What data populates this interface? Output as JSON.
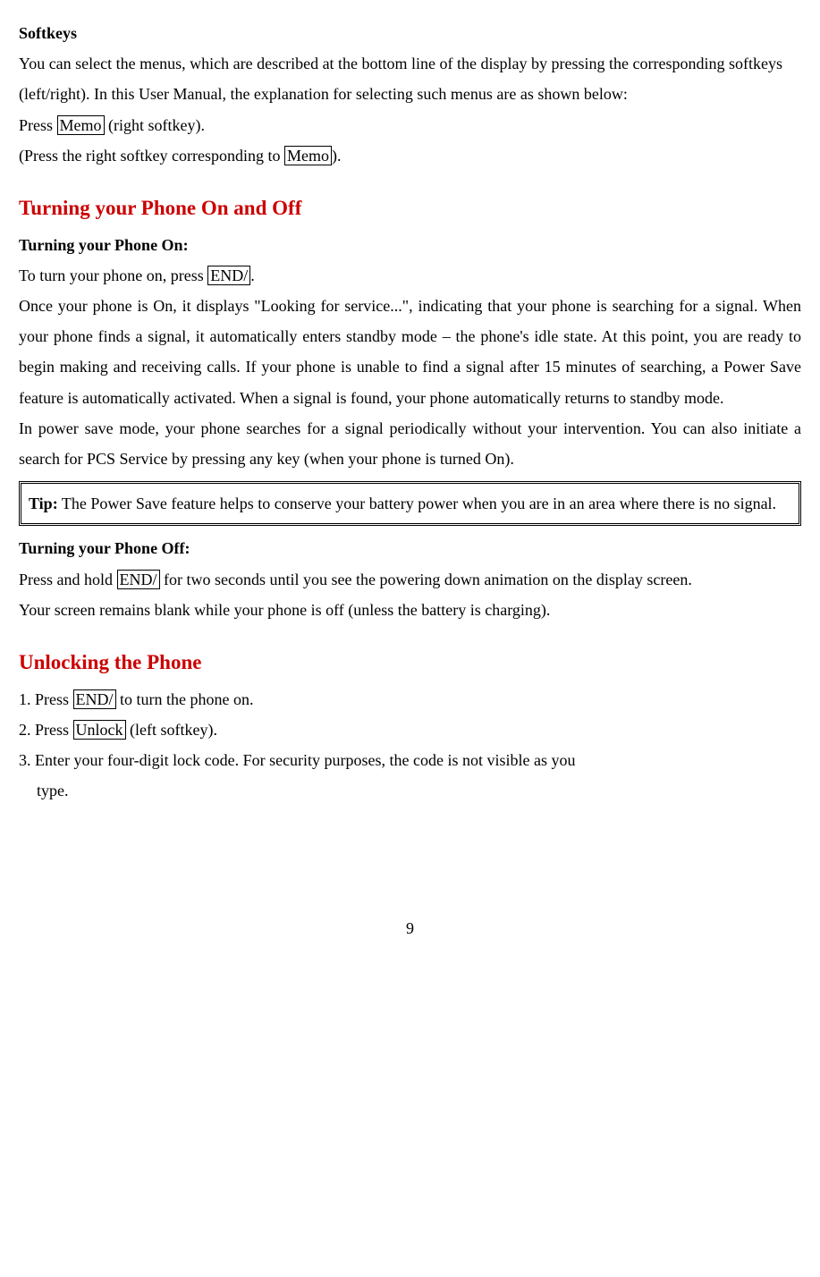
{
  "softkeys": {
    "heading": "Softkeys",
    "para1_a": "You can select the menus, which are described at the bottom line of the display by pressing the corresponding softkeys (left/right). In this User Manual, the explanation for selecting such menus are as shown below:",
    "para2_a": "Press ",
    "para2_boxed": "Memo",
    "para2_b": " (right softkey).",
    "para3_a": "(Press the right softkey corresponding to ",
    "para3_boxed": "Memo",
    "para3_b": ")."
  },
  "turning": {
    "main_heading": "Turning your Phone On and Off",
    "on_heading": "Turning your Phone On:",
    "on_p1_a": "To turn your phone on, press ",
    "on_p1_boxed": "END/",
    "on_p1_b": ".",
    "on_p2": "Once your phone is On, it displays \"Looking for service...\", indicating that your phone is searching for a signal. When your phone finds a signal, it automatically enters standby mode – the phone's idle state. At this point, you are ready to begin making and receiving calls. If your phone is unable to find a signal after 15 minutes of searching, a Power Save feature is automatically activated. When a signal is found, your phone automatically returns to standby mode.",
    "on_p3": "In power save mode, your phone searches for a signal periodically without your intervention. You can also initiate a search for PCS Service by pressing any key (when your phone is turned On).",
    "tip_label": "Tip:",
    "tip_text": " The Power Save feature helps to conserve your battery power when you are in an area where there is no signal.",
    "off_heading": "Turning your Phone Off:",
    "off_p1_a": "Press and hold ",
    "off_p1_boxed": "END/",
    "off_p1_b": " for two seconds until you see the powering down animation on the display screen.",
    "off_p2": "Your screen remains blank while your phone is off (unless the battery is charging)."
  },
  "unlocking": {
    "heading": "Unlocking the Phone",
    "step1_a": "1. Press ",
    "step1_boxed": "END/",
    "step1_b": " to turn the phone on.",
    "step2_a": "2. Press ",
    "step2_boxed": "Unlock",
    "step2_b": " (left softkey).",
    "step3_a": "3. Enter your four-digit lock code. For security purposes, the code is not visible as you",
    "step3_b": "type."
  },
  "page_number": "9"
}
